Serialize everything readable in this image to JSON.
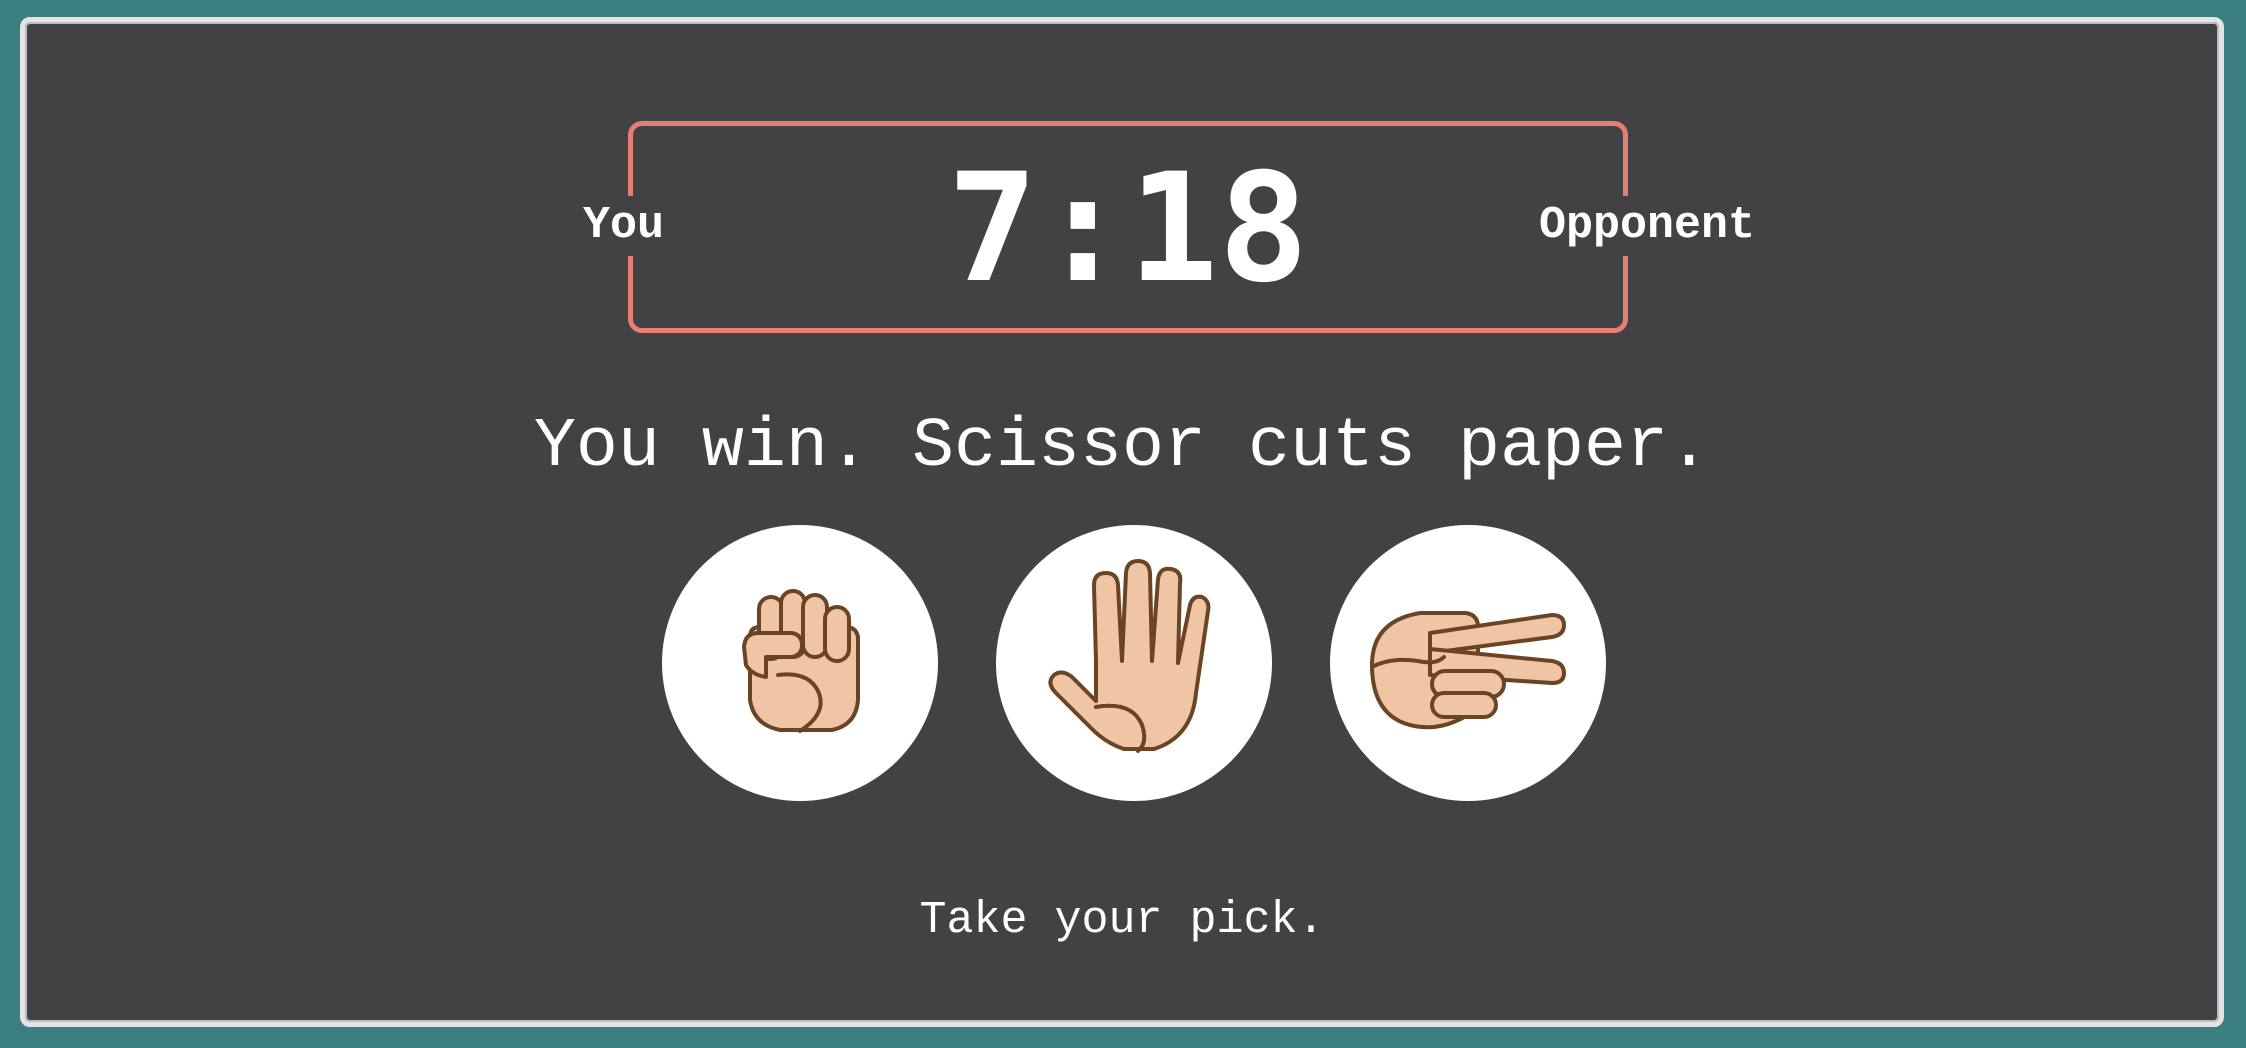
{
  "scoreboard": {
    "player_label": "You",
    "opponent_label": "Opponent",
    "score_text": "7:18",
    "player_score": 7,
    "opponent_score": 18
  },
  "result_message": "You win. Scissor cuts paper.",
  "choices": [
    {
      "icon": "rock-fist-icon"
    },
    {
      "icon": "paper-hand-icon"
    },
    {
      "icon": "scissors-hand-icon"
    }
  ],
  "prompt": "Take your pick.",
  "colors": {
    "background": "#3b7f80",
    "panel": "#424244",
    "accent": "#e47f72",
    "skin": "#f0c5a5",
    "outline": "#6b4423",
    "text": "#ffffff"
  }
}
